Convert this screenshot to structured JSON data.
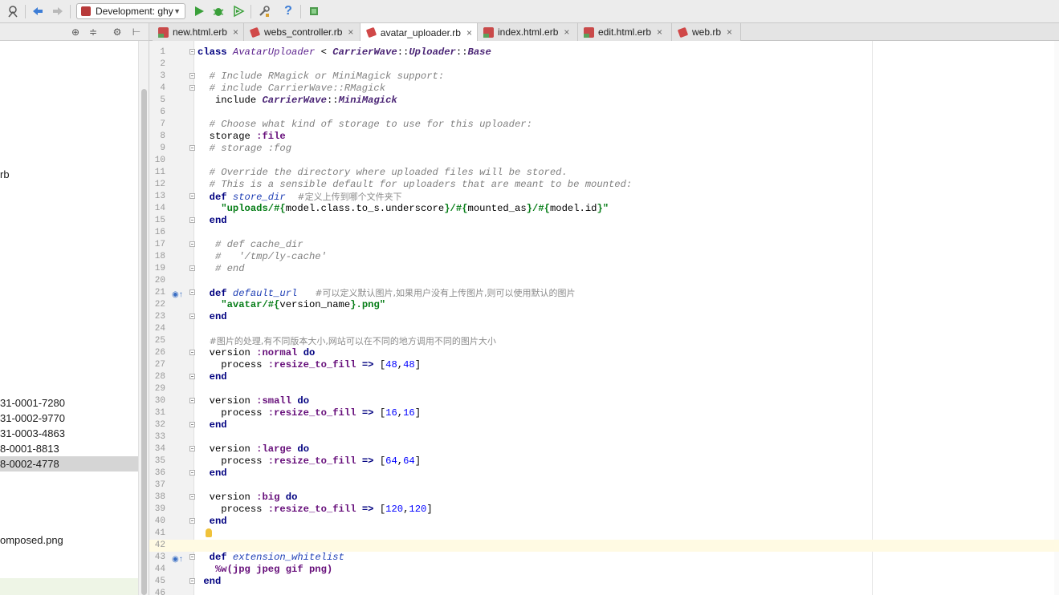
{
  "toolbar": {
    "run_config": "Development: ghy"
  },
  "tabs": [
    {
      "label": "new.html.erb",
      "type": "erb",
      "active": false
    },
    {
      "label": "webs_controller.rb",
      "type": "rb",
      "active": false
    },
    {
      "label": "avatar_uploader.rb",
      "type": "rb",
      "active": true
    },
    {
      "label": "index.html.erb",
      "type": "erb",
      "active": false
    },
    {
      "label": "edit.html.erb",
      "type": "erb",
      "active": false
    },
    {
      "label": "web.rb",
      "type": "rb",
      "active": false
    }
  ],
  "sidebar": {
    "items": [
      {
        "text": "rb",
        "selected": false
      },
      {
        "text": "31-0001-7280",
        "selected": false
      },
      {
        "text": "31-0002-9770",
        "selected": false
      },
      {
        "text": "31-0003-4863",
        "selected": false
      },
      {
        "text": "8-0001-8813",
        "selected": false
      },
      {
        "text": "8-0002-4778",
        "selected": true
      },
      {
        "text": "omposed.png",
        "selected": false
      }
    ]
  },
  "editor": {
    "line_numbers": [
      "1",
      "2",
      "3",
      "4",
      "5",
      "6",
      "7",
      "8",
      "9",
      "10",
      "11",
      "12",
      "13",
      "14",
      "15",
      "16",
      "17",
      "18",
      "19",
      "20",
      "21",
      "22",
      "23",
      "24",
      "25",
      "26",
      "27",
      "28",
      "29",
      "30",
      "31",
      "32",
      "33",
      "34",
      "35",
      "36",
      "37",
      "38",
      "39",
      "40",
      "41",
      "42",
      "43",
      "44",
      "45",
      "46"
    ],
    "tokens": {
      "l1": [
        "class",
        "AvatarUploader",
        " < ",
        "CarrierWave",
        "::",
        "Uploader",
        "::",
        "Base"
      ],
      "l3": "# Include RMagick or MiniMagick support:",
      "l4": "# include CarrierWave::RMagick",
      "l5": [
        "include",
        "CarrierWave",
        "::",
        "MiniMagick"
      ],
      "l7": "# Choose what kind of storage to use for this uploader:",
      "l8": [
        "storage",
        ":file"
      ],
      "l9": [
        "# storage ",
        ":fog"
      ],
      "l11": "# Override the directory where uploaded files will be stored.",
      "l12": "# This is a sensible default for uploaders that are meant to be mounted:",
      "l13": [
        "def",
        "store_dir",
        "#定义上传到哪个文件夹下"
      ],
      "l14": [
        "\"uploads/",
        "#{",
        "model.class.to_s.underscore",
        "}",
        "/",
        "#{",
        "mounted_as",
        "}",
        "/",
        "#{",
        "model.id",
        "}",
        "\""
      ],
      "l15": "end",
      "l17": [
        "# ",
        "def",
        " cache_dir"
      ],
      "l18": [
        "#   ",
        "'/tmp/ly-cache'"
      ],
      "l19": [
        "# ",
        "end"
      ],
      "l21": [
        "def",
        "default_url",
        "#可以定义默认图片,如果用户没有上传图片,则可以使用默认的图片"
      ],
      "l22": [
        "\"avatar/",
        "#{",
        "version_name",
        "}",
        ".png\""
      ],
      "l23": "end",
      "l25": "#图片的处理,有不同版本大小,网站可以在不同的地方调用不同的图片大小",
      "l26": [
        "version",
        ":normal",
        "do"
      ],
      "l27": [
        "process",
        ":resize_to_fill",
        "=>",
        "[",
        "48",
        ",",
        "48",
        "]"
      ],
      "l28": "end",
      "l30": [
        "version",
        ":small",
        "do"
      ],
      "l31": [
        "process",
        ":resize_to_fill",
        "=>",
        "[",
        "16",
        ",",
        "16",
        "]"
      ],
      "l32": "end",
      "l34": [
        "version",
        ":large",
        "do"
      ],
      "l35": [
        "process",
        ":resize_to_fill",
        "=>",
        "[",
        "64",
        ",",
        "64",
        "]"
      ],
      "l36": "end",
      "l38": [
        "version",
        ":big",
        "do"
      ],
      "l39": [
        "process",
        ":resize_to_fill",
        "=>",
        "[",
        "120",
        ",",
        "120",
        "]"
      ],
      "l40": "end",
      "l43": [
        "def",
        "extension_whitelist"
      ],
      "l44": "%w(jpg jpeg gif png)",
      "l45": "end"
    }
  },
  "colors": {
    "keyword": "#000080",
    "comment": "#808080",
    "string": "#067d17",
    "symbol": "#660e7a",
    "number": "#0000ff",
    "caret_line": "#fffae3"
  }
}
